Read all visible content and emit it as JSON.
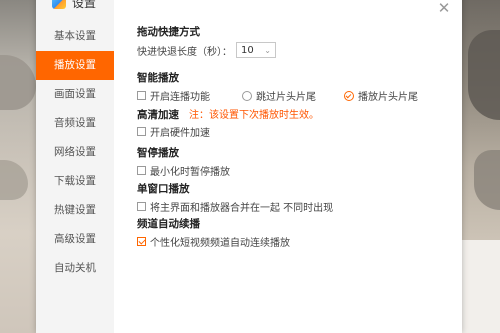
{
  "window": {
    "title": "设置",
    "close_glyph": "✕"
  },
  "sidebar": {
    "items": [
      {
        "label": "基本设置",
        "active": false
      },
      {
        "label": "播放设置",
        "active": true
      },
      {
        "label": "画面设置",
        "active": false
      },
      {
        "label": "音频设置",
        "active": false
      },
      {
        "label": "网络设置",
        "active": false
      },
      {
        "label": "下载设置",
        "active": false
      },
      {
        "label": "热键设置",
        "active": false
      },
      {
        "label": "高级设置",
        "active": false
      },
      {
        "label": "自动关机",
        "active": false
      }
    ]
  },
  "sections": {
    "fast_forward": {
      "title": "拖动快捷方式",
      "label": "快进快退长度（秒）：",
      "value": "10",
      "arrow": "⌄"
    },
    "smart_play": {
      "title": "智能播放",
      "continuous": {
        "label": "开启连播功能",
        "checked": false
      },
      "skip_intro": {
        "label": "跳过片头片尾",
        "checked": false
      },
      "play_intro": {
        "label": "播放片头片尾",
        "checked": true
      }
    },
    "hd_accel": {
      "title": "高清加速",
      "note": "注：该设置下次播放时生效。",
      "hw_accel": {
        "label": "开启硬件加速",
        "checked": false
      }
    },
    "pause": {
      "title": "智停播放",
      "minimize_pause": {
        "label": "最小化时暂停播放",
        "checked": false
      }
    },
    "single_window": {
      "title": "单窗口播放",
      "merge": {
        "label": "将主界面和播放器合并在一起 不同时出现",
        "checked": false
      }
    },
    "channel_autoplay": {
      "title": "频道自动续播",
      "personalized": {
        "label": "个性化短视频频道自动连续播放",
        "checked": true
      }
    }
  },
  "colors": {
    "accent": "#ff6600",
    "warning": "#ff5500"
  }
}
